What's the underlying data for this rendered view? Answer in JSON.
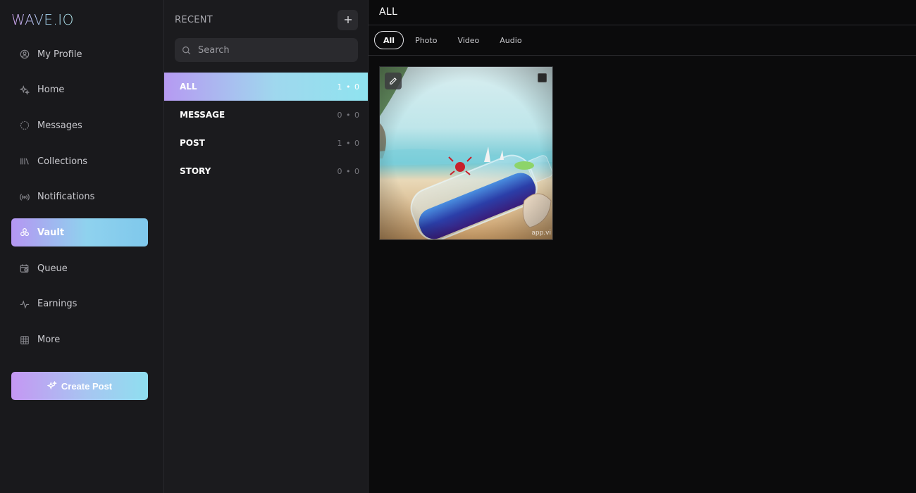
{
  "app": {
    "logo": "WAVE.IO"
  },
  "sidebar": {
    "items": [
      {
        "label": "My Profile",
        "icon": "user-circle-icon"
      },
      {
        "label": "Home",
        "icon": "sparkle-icon"
      },
      {
        "label": "Messages",
        "icon": "chat-bubble-icon"
      },
      {
        "label": "Collections",
        "icon": "library-icon"
      },
      {
        "label": "Notifications",
        "icon": "broadcast-icon"
      },
      {
        "label": "Vault",
        "icon": "vault-icon",
        "active": true
      },
      {
        "label": "Queue",
        "icon": "calendar-clock-icon"
      },
      {
        "label": "Earnings",
        "icon": "pulse-icon"
      },
      {
        "label": "More",
        "icon": "grid-icon"
      }
    ],
    "create_post_label": "Create Post"
  },
  "recent": {
    "title": "RECENT",
    "search_placeholder": "Search",
    "categories": [
      {
        "label": "ALL",
        "count": "1 • 0",
        "active": true
      },
      {
        "label": "MESSAGE",
        "count": "0 • 0"
      },
      {
        "label": "POST",
        "count": "1 • 0"
      },
      {
        "label": "STORY",
        "count": "0 • 0"
      }
    ]
  },
  "main": {
    "title": "ALL",
    "tabs": [
      {
        "label": "All",
        "active": true
      },
      {
        "label": "Photo"
      },
      {
        "label": "Video"
      },
      {
        "label": "Audio"
      }
    ],
    "media": {
      "watermark": "app.vi"
    }
  },
  "colors": {
    "accent_start": "#b596f2",
    "accent_end": "#8fdff0",
    "background": "#0b0b0c",
    "panel": "#19191c"
  }
}
